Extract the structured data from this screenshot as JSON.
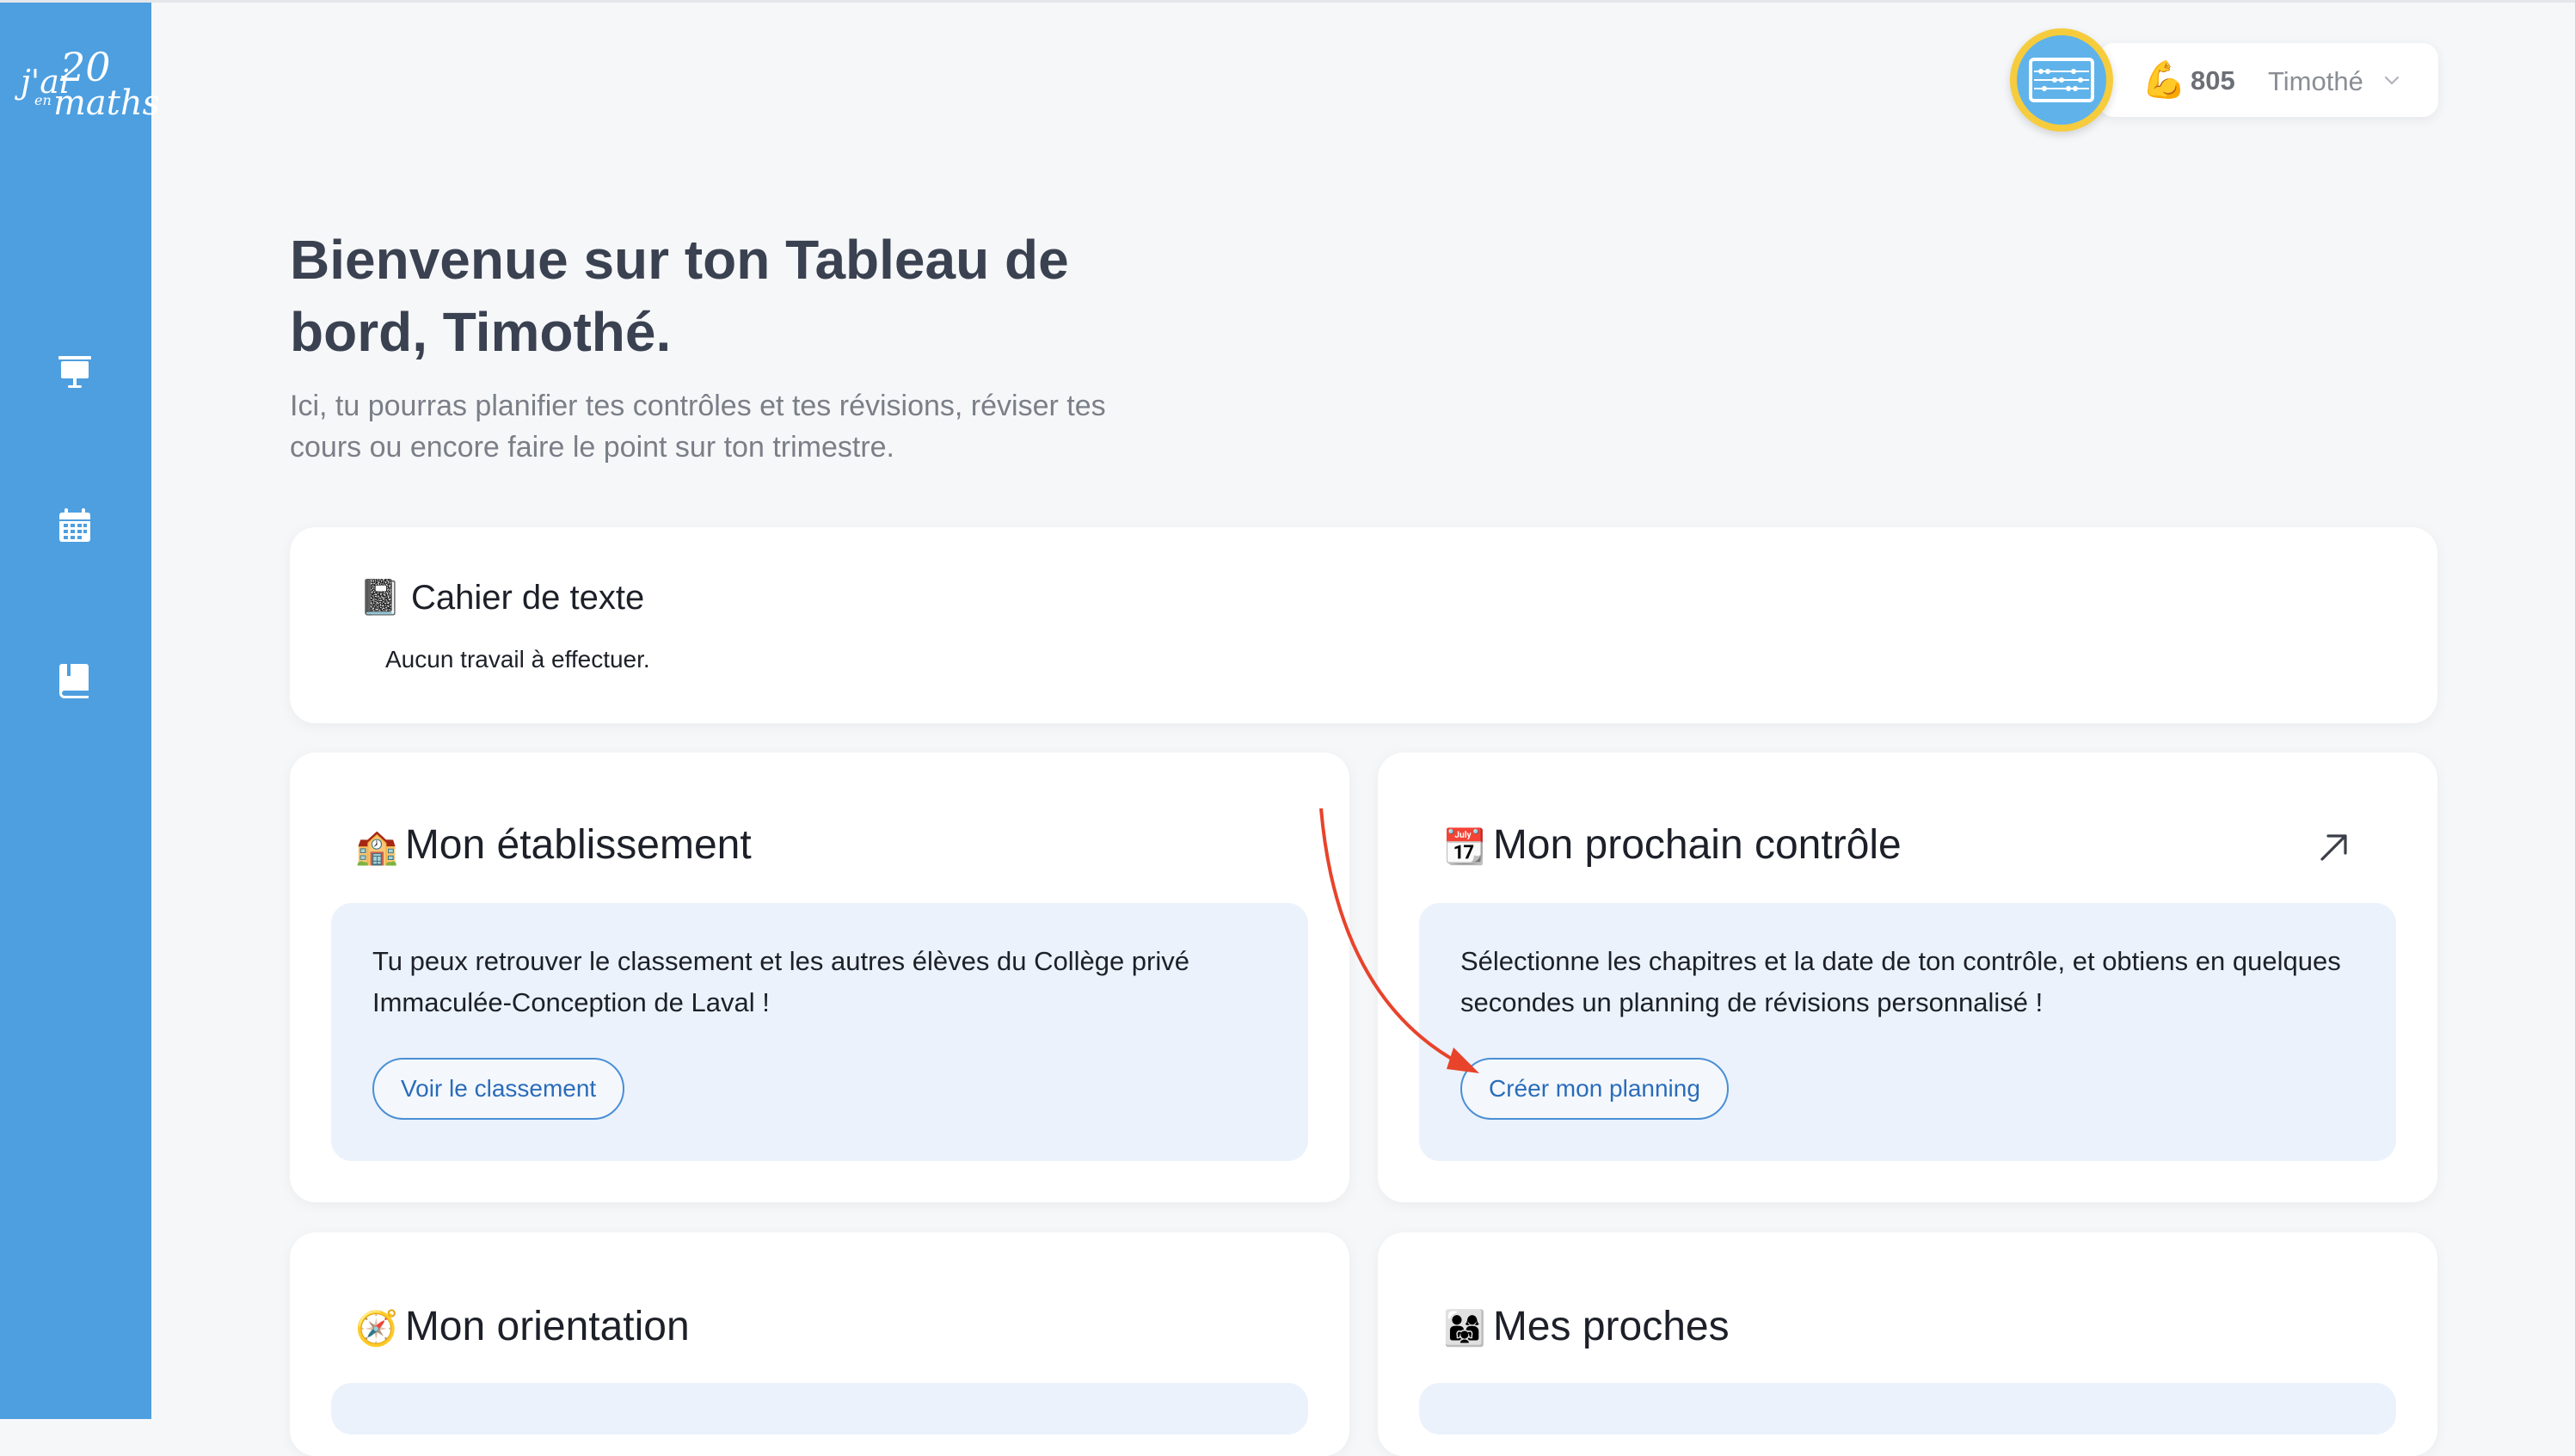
{
  "sidebar": {
    "logo": {
      "line1": "j'ai",
      "line2": "20",
      "line3": "en",
      "line4": "maths"
    },
    "nav": [
      {
        "icon": "presentation-board-icon"
      },
      {
        "icon": "calendar-icon"
      },
      {
        "icon": "book-icon"
      }
    ]
  },
  "user": {
    "avatar_icon": "abacus-avatar-icon",
    "points_icon": "flexed-biceps-icon",
    "points": "805",
    "name": "Timothé"
  },
  "header": {
    "title": "Bienvenue sur ton Tableau de bord, Timothé.",
    "subtitle": "Ici, tu pourras planifier tes contrôles et tes révisions, réviser tes cours ou encore faire le point sur ton trimestre."
  },
  "cahier": {
    "emoji": "📓",
    "title": "Cahier de texte",
    "empty_text": "Aucun travail à effectuer."
  },
  "etablissement": {
    "emoji": "🏫",
    "title": "Mon établissement",
    "text": "Tu peux retrouver le classement et les autres élèves du Collège privé Immaculée-Conception de Laval !",
    "button": "Voir le classement"
  },
  "controle": {
    "emoji": "📆",
    "title": "Mon prochain contrôle",
    "text": "Sélectionne les chapitres et la date de ton contrôle, et obtiens en quelques secondes un planning de révisions personnalisé !",
    "button": "Créer mon planning",
    "link_icon": "arrow-up-right-icon"
  },
  "orientation": {
    "emoji": "🧭",
    "title": "Mon orientation"
  },
  "proches": {
    "emoji": "👨‍👩‍👧",
    "title": "Mes proches"
  },
  "colors": {
    "sidebar": "#4d9fe0",
    "accent": "#2b6cb9",
    "annotation_arrow": "#e8432b"
  }
}
